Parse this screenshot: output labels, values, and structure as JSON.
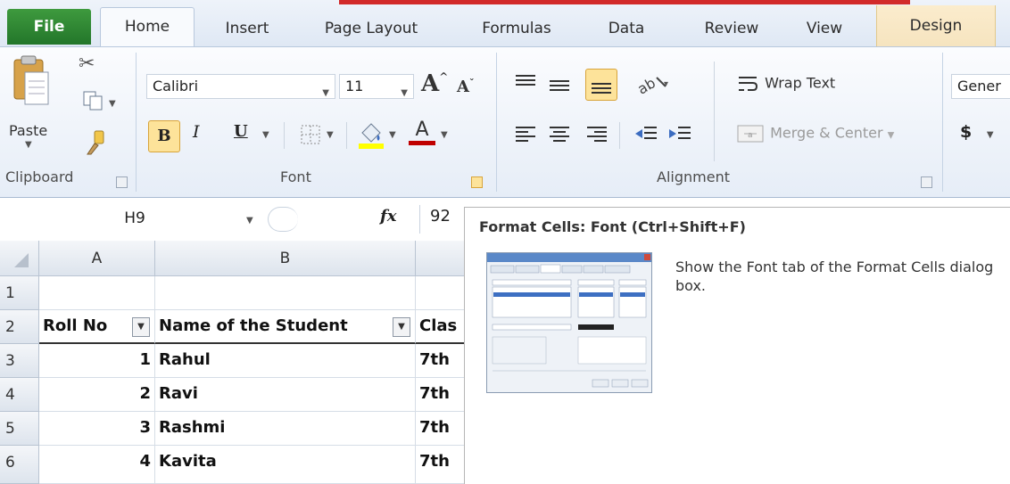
{
  "tabs": {
    "file": "File",
    "home": "Home",
    "insert": "Insert",
    "page_layout": "Page Layout",
    "formulas": "Formulas",
    "data": "Data",
    "review": "Review",
    "view": "View",
    "design": "Design"
  },
  "ribbon": {
    "clipboard": {
      "paste_label": "Paste",
      "group_label": "Clipboard"
    },
    "font": {
      "font_name": "Calibri",
      "font_size": "11",
      "grow_label": "A",
      "shrink_label": "A",
      "bold": "B",
      "italic": "I",
      "underline": "U",
      "font_color_label": "A",
      "group_label": "Font"
    },
    "alignment": {
      "wrap_text": "Wrap Text",
      "merge_center": "Merge & Center",
      "group_label": "Alignment"
    },
    "number": {
      "format": "Gener",
      "currency_symbol": "$"
    }
  },
  "formula_bar": {
    "name_box": "H9",
    "fx_label": "fx",
    "value": "92"
  },
  "sheet": {
    "columns": [
      "A",
      "B"
    ],
    "rows": [
      {
        "num": "1",
        "a": "",
        "b": "",
        "c": ""
      },
      {
        "num": "2",
        "a": "Roll No",
        "b": "Name of the Student",
        "c": "Clas"
      },
      {
        "num": "3",
        "a": "1",
        "b": "Rahul",
        "c": "7th"
      },
      {
        "num": "4",
        "a": "2",
        "b": "Ravi",
        "c": "7th"
      },
      {
        "num": "5",
        "a": "3",
        "b": "Rashmi",
        "c": "7th"
      },
      {
        "num": "6",
        "a": "4",
        "b": "Kavita",
        "c": "7th"
      }
    ]
  },
  "tooltip": {
    "title": "Format Cells: Font (Ctrl+Shift+F)",
    "description": "Show the Font tab of the Format Cells dialog box."
  },
  "colors": {
    "file_tab": "#2b7d30",
    "highlight": "#fde39a",
    "annotation": "#e01a1a",
    "font_color_bar": "#c00000",
    "fill_color_bar": "#ffff00"
  }
}
